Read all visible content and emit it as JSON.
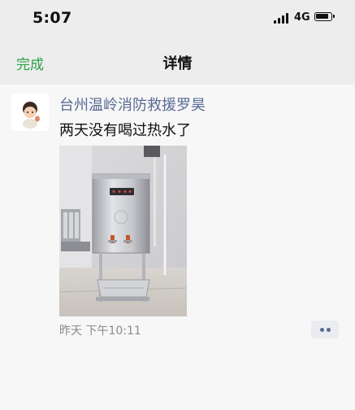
{
  "status_bar": {
    "time": "5:07",
    "network": "4G",
    "icons": [
      "signal-icon",
      "battery-icon"
    ]
  },
  "nav": {
    "done_label": "完成",
    "title": "详情"
  },
  "post": {
    "author": "台州温岭消防救援罗昊",
    "text": "两天没有喝过热水了",
    "timestamp": "昨天  下午10:11",
    "more_icon": "more-dots-icon"
  },
  "colors": {
    "accent_green": "#2ba245",
    "link_blue": "#576b95",
    "background": "#f7f7f7",
    "bar": "#ededed"
  }
}
